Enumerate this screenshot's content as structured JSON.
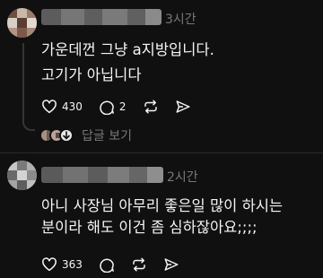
{
  "posts": [
    {
      "time": "3시간",
      "lines": [
        "가운데껀 그냥 a지방입니다.",
        "고기가 아닙니다"
      ],
      "likes": "430",
      "comments": "2",
      "replies_label": "답글 보기"
    },
    {
      "time": "2시간",
      "lines": [
        "아니 사장님 아무리 좋은일 많이 하시는",
        "분이라 해도 이건 좀 심하잖아요;;;;"
      ],
      "likes": "363"
    }
  ]
}
